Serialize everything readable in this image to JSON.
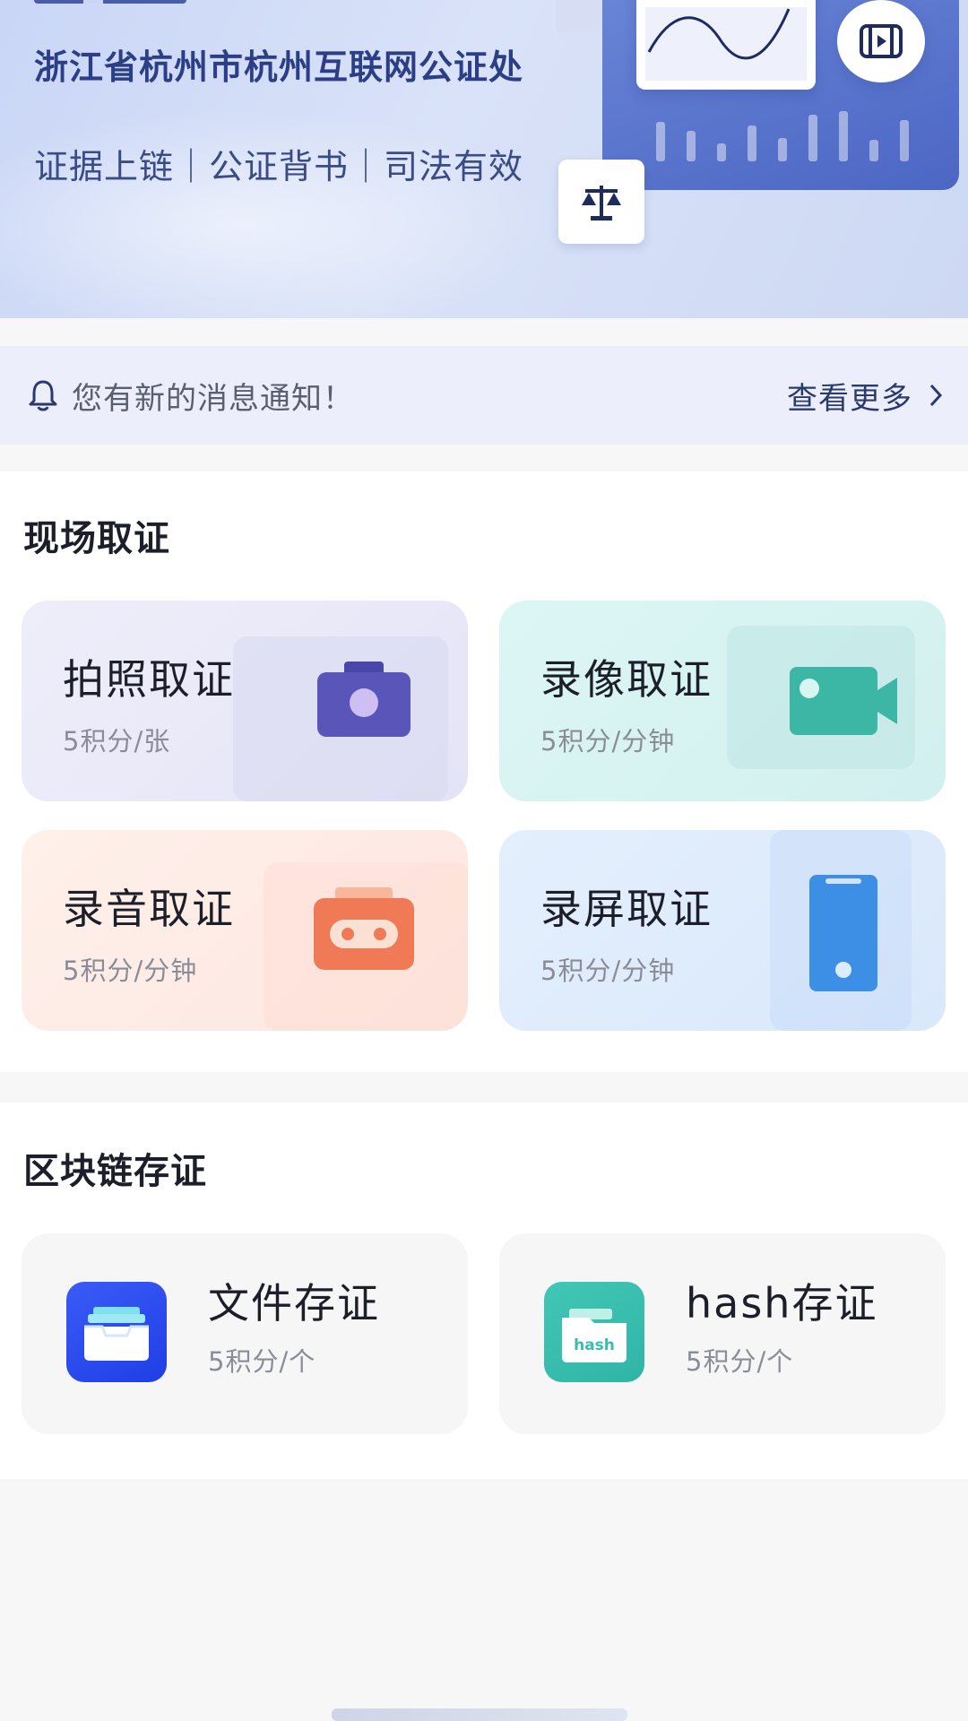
{
  "banner": {
    "notary_office": "浙江省杭州市杭州互联网公证处",
    "slogan": "证据上链｜公证背书｜司法有效",
    "icons": [
      "line-chart-icon",
      "video-icon",
      "scale-icon"
    ]
  },
  "notice": {
    "text": "您有新的消息通知！",
    "more_label": "查看更多"
  },
  "onsite": {
    "title": "现场取证",
    "cards": [
      {
        "title": "拍照取证",
        "sub": "5积分/张",
        "icon": "camera-icon",
        "color": "#5a55b8"
      },
      {
        "title": "录像取证",
        "sub": "5积分/分钟",
        "icon": "video-camera-icon",
        "color": "#3cb7a6"
      },
      {
        "title": "录音取证",
        "sub": "5积分/分钟",
        "icon": "cassette-icon",
        "color": "#f07a55"
      },
      {
        "title": "录屏取证",
        "sub": "5积分/分钟",
        "icon": "phone-icon",
        "color": "#3d8fe6"
      }
    ]
  },
  "blockchain": {
    "title": "区块链存证",
    "cards": [
      {
        "title": "文件存证",
        "sub": "5积分/个",
        "icon": "file-tray-icon",
        "color": "#2d4ef0"
      },
      {
        "title": "hash存证",
        "sub": "5积分/个",
        "icon": "hash-folder-icon",
        "color": "#38bdae",
        "icon_text": "hash"
      }
    ]
  }
}
